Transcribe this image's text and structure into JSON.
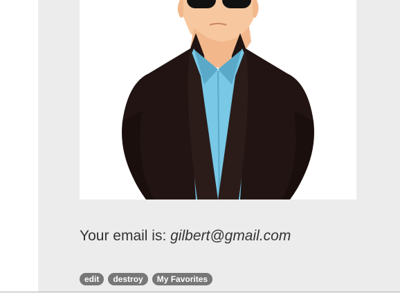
{
  "profile": {
    "email_prefix": "Your email is: ",
    "email": "gilbert@gmail.com",
    "avatar_icon": "man-in-sunglasses-avatar"
  },
  "actions": {
    "edit_label": "edit",
    "destroy_label": "destroy",
    "favorites_label": "My Favorites"
  },
  "colors": {
    "panel": "#ececec",
    "pill": "#777777",
    "jacket": "#211412",
    "shirt": "#78c8e6",
    "skin": "#f7c8a0"
  }
}
